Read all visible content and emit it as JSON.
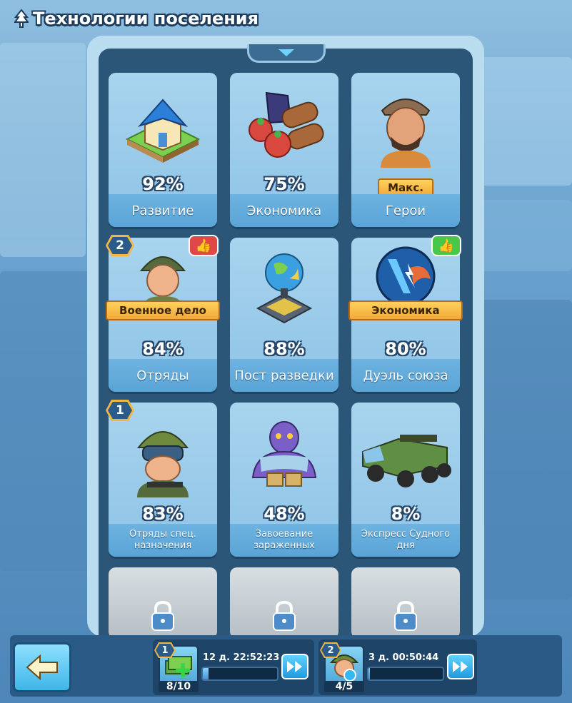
{
  "header": {
    "title": "Технологии поселения",
    "icon": "tree-icon"
  },
  "cards": [
    {
      "label": "Развитие",
      "percent": "92%",
      "icon": "house-icon"
    },
    {
      "label": "Экономика",
      "percent": "75%",
      "icon": "resources-icon"
    },
    {
      "label": "Герои",
      "ribbon": "Макс.",
      "icon": "hero-portrait-icon"
    },
    {
      "label": "Отряды",
      "percent": "84%",
      "ribbon": "Военное дело",
      "badge": "2",
      "thumb": "red",
      "icon": "soldier-icon"
    },
    {
      "label": "Пост разведки",
      "percent": "88%",
      "icon": "radar-globe-icon"
    },
    {
      "label": "Дуэль союза",
      "percent": "80%",
      "ribbon": "Экономика",
      "thumb": "green",
      "icon": "duel-shield-icon"
    },
    {
      "label": "Отряды спец. назначения",
      "percent": "83%",
      "badge": "1",
      "icon": "special-forces-icon"
    },
    {
      "label": "Завоевание зараженных",
      "percent": "48%",
      "icon": "zombie-icon"
    },
    {
      "label": "Экспресс Судного дня",
      "percent": "8%",
      "icon": "armored-truck-icon"
    }
  ],
  "locked_cards": [
    {
      "icon": "lock-icon"
    },
    {
      "icon": "lock-icon"
    },
    {
      "icon": "lock-icon"
    }
  ],
  "bottom": {
    "back_icon": "arrow-left-icon",
    "queues": [
      {
        "badge": "1",
        "timer": "12 д. 22:52:23",
        "count": "8/10",
        "progress": 0.08
      },
      {
        "badge": "2",
        "timer": "3 д. 00:50:44",
        "count": "4/5",
        "progress": 0.02
      }
    ]
  },
  "colors": {
    "accent": "#3eb6e8",
    "ribbon": "#f1a93a",
    "thumb_red": "#e04848",
    "thumb_green": "#49c74a"
  }
}
